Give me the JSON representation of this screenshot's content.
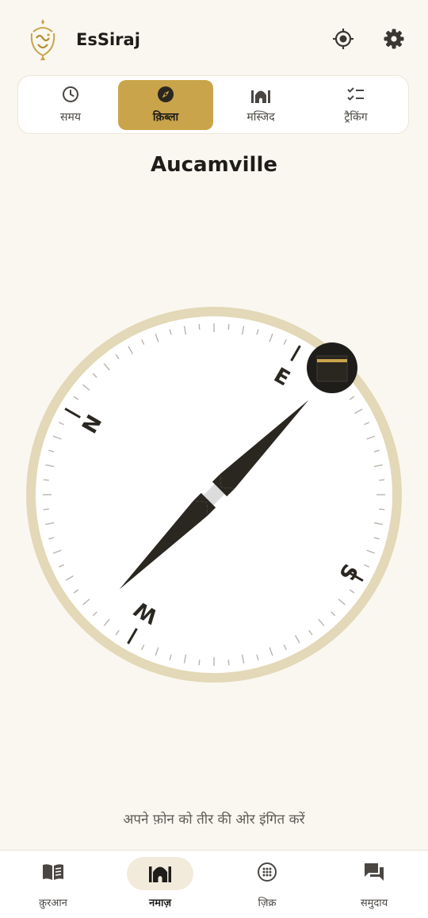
{
  "app": {
    "title": "EsSiraj",
    "logo_text": "سراج"
  },
  "header": {
    "location_icon": "my-location-icon",
    "settings_icon": "gear-icon"
  },
  "tabs": [
    {
      "label": "समय",
      "icon": "clock-icon",
      "active": false
    },
    {
      "label": "क़िब्ला",
      "icon": "compass-icon",
      "active": true
    },
    {
      "label": "मस्जिद",
      "icon": "mosque-icon",
      "active": false
    },
    {
      "label": "ट्रैकिंग",
      "icon": "checklist-icon",
      "active": false
    }
  ],
  "city": "Aucamville",
  "compass": {
    "cardinals": {
      "north": "N",
      "east": "E",
      "south": "S",
      "west": "W"
    },
    "qibla_icon": "kaaba-icon"
  },
  "hint": "अपने फ़ोन को तीर की ओर इंगित करें",
  "bottom_nav": [
    {
      "label": "क़ुरआन",
      "icon": "book-icon",
      "active": false
    },
    {
      "label": "नमाज़",
      "icon": "mosque-icon",
      "active": true
    },
    {
      "label": "ज़िक्र",
      "icon": "tasbih-icon",
      "active": false
    },
    {
      "label": "समुदाय",
      "icon": "chat-icon",
      "active": false
    }
  ],
  "colors": {
    "accent": "#c9a44a",
    "ring": "#e3d8b7",
    "background": "#faf7f0",
    "needle": "#2a2620"
  }
}
